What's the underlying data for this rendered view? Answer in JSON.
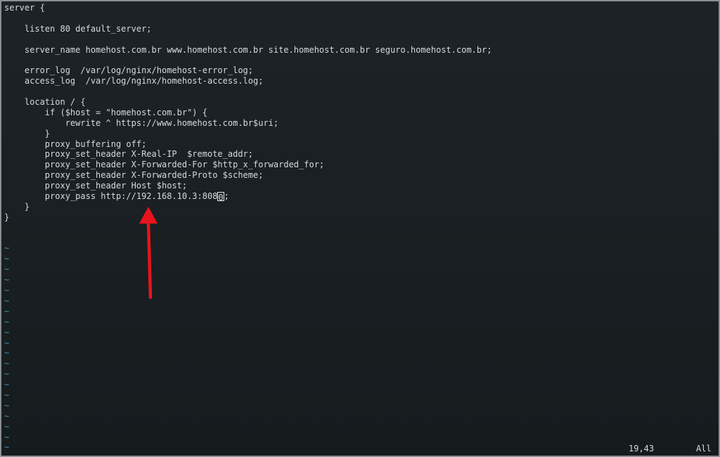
{
  "editor": {
    "lines": [
      "server {",
      "",
      "    listen 80 default_server;",
      "",
      "    server_name homehost.com.br www.homehost.com.br site.homehost.com.br seguro.homehost.com.br;",
      "",
      "    error_log  /var/log/nginx/homehost-error_log;",
      "    access_log  /var/log/nginx/homehost-access.log;",
      "",
      "    location / {",
      "        if ($host = \"homehost.com.br\") {",
      "            rewrite ^ https://www.homehost.com.br$uri;",
      "        }",
      "        proxy_buffering off;",
      "        proxy_set_header X-Real-IP  $remote_addr;",
      "        proxy_set_header X-Forwarded-For $http_x_forwarded_for;",
      "        proxy_set_header X-Forwarded-Proto $scheme;",
      "        proxy_set_header Host $host;",
      "        proxy_pass http://192.168.10.3:808",
      "    }",
      "}",
      "",
      "",
      "~",
      "~",
      "~",
      "~",
      "~",
      "~",
      "~",
      "~",
      "~",
      "~",
      "~",
      "~",
      "~",
      "~",
      "~",
      "~",
      "~",
      "~",
      "~",
      "~"
    ],
    "cursor_line_suffix": ";",
    "cursor_char": "0"
  },
  "status": {
    "position": "19,43",
    "scroll": "All"
  },
  "colors": {
    "text": "#d8dadb",
    "tilde": "#4a8fb3",
    "arrow": "#e8141c"
  }
}
